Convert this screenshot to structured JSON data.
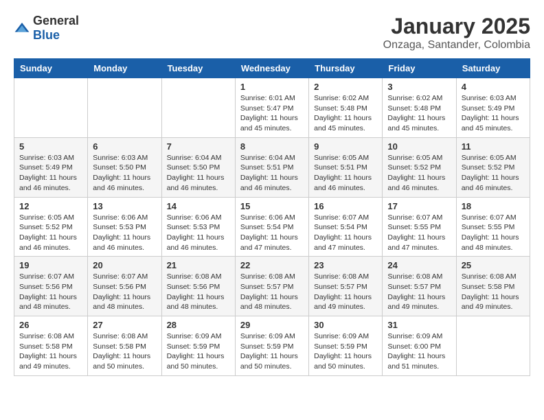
{
  "header": {
    "logo_general": "General",
    "logo_blue": "Blue",
    "month_year": "January 2025",
    "location": "Onzaga, Santander, Colombia"
  },
  "weekdays": [
    "Sunday",
    "Monday",
    "Tuesday",
    "Wednesday",
    "Thursday",
    "Friday",
    "Saturday"
  ],
  "weeks": [
    [
      {
        "day": "",
        "info": ""
      },
      {
        "day": "",
        "info": ""
      },
      {
        "day": "",
        "info": ""
      },
      {
        "day": "1",
        "info": "Sunrise: 6:01 AM\nSunset: 5:47 PM\nDaylight: 11 hours and 45 minutes."
      },
      {
        "day": "2",
        "info": "Sunrise: 6:02 AM\nSunset: 5:48 PM\nDaylight: 11 hours and 45 minutes."
      },
      {
        "day": "3",
        "info": "Sunrise: 6:02 AM\nSunset: 5:48 PM\nDaylight: 11 hours and 45 minutes."
      },
      {
        "day": "4",
        "info": "Sunrise: 6:03 AM\nSunset: 5:49 PM\nDaylight: 11 hours and 45 minutes."
      }
    ],
    [
      {
        "day": "5",
        "info": "Sunrise: 6:03 AM\nSunset: 5:49 PM\nDaylight: 11 hours and 46 minutes."
      },
      {
        "day": "6",
        "info": "Sunrise: 6:03 AM\nSunset: 5:50 PM\nDaylight: 11 hours and 46 minutes."
      },
      {
        "day": "7",
        "info": "Sunrise: 6:04 AM\nSunset: 5:50 PM\nDaylight: 11 hours and 46 minutes."
      },
      {
        "day": "8",
        "info": "Sunrise: 6:04 AM\nSunset: 5:51 PM\nDaylight: 11 hours and 46 minutes."
      },
      {
        "day": "9",
        "info": "Sunrise: 6:05 AM\nSunset: 5:51 PM\nDaylight: 11 hours and 46 minutes."
      },
      {
        "day": "10",
        "info": "Sunrise: 6:05 AM\nSunset: 5:52 PM\nDaylight: 11 hours and 46 minutes."
      },
      {
        "day": "11",
        "info": "Sunrise: 6:05 AM\nSunset: 5:52 PM\nDaylight: 11 hours and 46 minutes."
      }
    ],
    [
      {
        "day": "12",
        "info": "Sunrise: 6:05 AM\nSunset: 5:52 PM\nDaylight: 11 hours and 46 minutes."
      },
      {
        "day": "13",
        "info": "Sunrise: 6:06 AM\nSunset: 5:53 PM\nDaylight: 11 hours and 46 minutes."
      },
      {
        "day": "14",
        "info": "Sunrise: 6:06 AM\nSunset: 5:53 PM\nDaylight: 11 hours and 46 minutes."
      },
      {
        "day": "15",
        "info": "Sunrise: 6:06 AM\nSunset: 5:54 PM\nDaylight: 11 hours and 47 minutes."
      },
      {
        "day": "16",
        "info": "Sunrise: 6:07 AM\nSunset: 5:54 PM\nDaylight: 11 hours and 47 minutes."
      },
      {
        "day": "17",
        "info": "Sunrise: 6:07 AM\nSunset: 5:55 PM\nDaylight: 11 hours and 47 minutes."
      },
      {
        "day": "18",
        "info": "Sunrise: 6:07 AM\nSunset: 5:55 PM\nDaylight: 11 hours and 48 minutes."
      }
    ],
    [
      {
        "day": "19",
        "info": "Sunrise: 6:07 AM\nSunset: 5:56 PM\nDaylight: 11 hours and 48 minutes."
      },
      {
        "day": "20",
        "info": "Sunrise: 6:07 AM\nSunset: 5:56 PM\nDaylight: 11 hours and 48 minutes."
      },
      {
        "day": "21",
        "info": "Sunrise: 6:08 AM\nSunset: 5:56 PM\nDaylight: 11 hours and 48 minutes."
      },
      {
        "day": "22",
        "info": "Sunrise: 6:08 AM\nSunset: 5:57 PM\nDaylight: 11 hours and 48 minutes."
      },
      {
        "day": "23",
        "info": "Sunrise: 6:08 AM\nSunset: 5:57 PM\nDaylight: 11 hours and 49 minutes."
      },
      {
        "day": "24",
        "info": "Sunrise: 6:08 AM\nSunset: 5:57 PM\nDaylight: 11 hours and 49 minutes."
      },
      {
        "day": "25",
        "info": "Sunrise: 6:08 AM\nSunset: 5:58 PM\nDaylight: 11 hours and 49 minutes."
      }
    ],
    [
      {
        "day": "26",
        "info": "Sunrise: 6:08 AM\nSunset: 5:58 PM\nDaylight: 11 hours and 49 minutes."
      },
      {
        "day": "27",
        "info": "Sunrise: 6:08 AM\nSunset: 5:58 PM\nDaylight: 11 hours and 50 minutes."
      },
      {
        "day": "28",
        "info": "Sunrise: 6:09 AM\nSunset: 5:59 PM\nDaylight: 11 hours and 50 minutes."
      },
      {
        "day": "29",
        "info": "Sunrise: 6:09 AM\nSunset: 5:59 PM\nDaylight: 11 hours and 50 minutes."
      },
      {
        "day": "30",
        "info": "Sunrise: 6:09 AM\nSunset: 5:59 PM\nDaylight: 11 hours and 50 minutes."
      },
      {
        "day": "31",
        "info": "Sunrise: 6:09 AM\nSunset: 6:00 PM\nDaylight: 11 hours and 51 minutes."
      },
      {
        "day": "",
        "info": ""
      }
    ]
  ]
}
